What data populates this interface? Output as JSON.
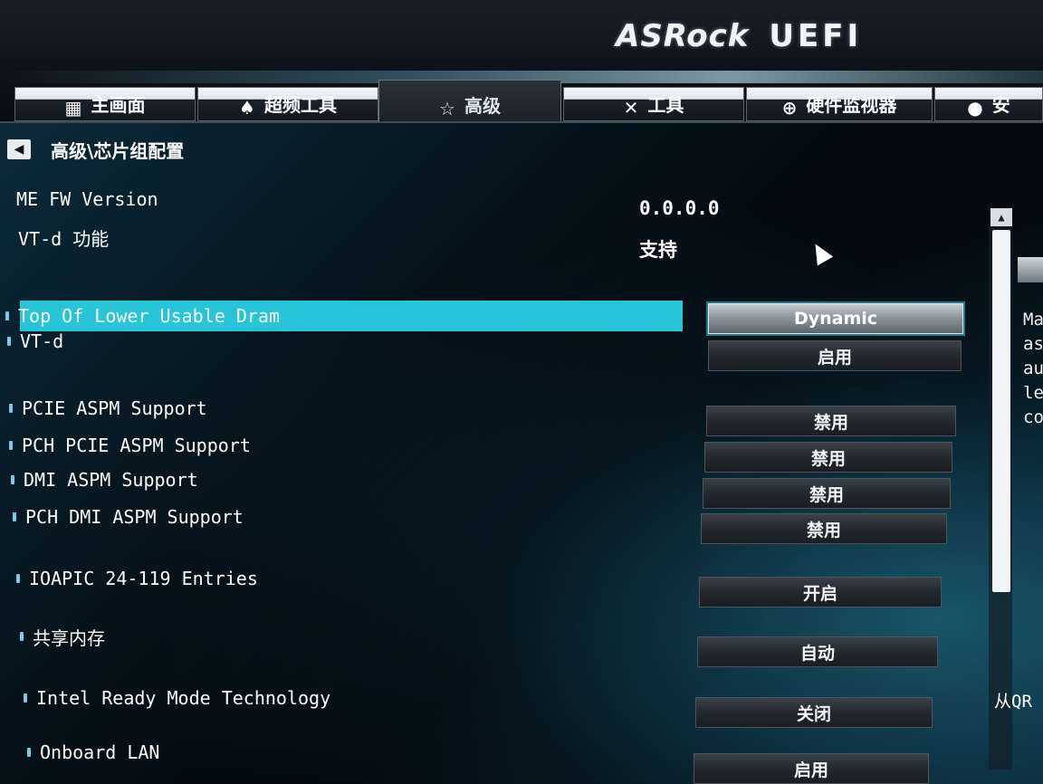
{
  "header": {
    "brand": "ASRock",
    "product": "UEFI"
  },
  "tabs": [
    {
      "label": "主画面",
      "icon": "home-icon"
    },
    {
      "label": "超频工具",
      "icon": "flame-icon"
    },
    {
      "label": "高级",
      "icon": "star-icon"
    },
    {
      "label": "工具",
      "icon": "tools-icon"
    },
    {
      "label": "硬件监视器",
      "icon": "monitor-icon"
    },
    {
      "label": "安",
      "icon": "lock-icon"
    }
  ],
  "breadcrumb": "高级\\芯片组配置",
  "info": [
    {
      "label": "ME FW Version",
      "value": "0.0.0.0"
    },
    {
      "label": "VT-d 功能",
      "value": "支持"
    }
  ],
  "settings": [
    {
      "label": "Top Of Lower Usable Dram",
      "value": "Dynamic"
    },
    {
      "label": "VT-d",
      "value": "启用"
    },
    {
      "label": "PCIE ASPM Support",
      "value": "禁用"
    },
    {
      "label": "PCH PCIE ASPM Support",
      "value": "禁用"
    },
    {
      "label": "DMI ASPM Support",
      "value": "禁用"
    },
    {
      "label": "PCH DMI ASPM Support",
      "value": "禁用"
    },
    {
      "label": "IOAPIC 24-119 Entries",
      "value": "开启"
    },
    {
      "label": "共享内存",
      "value": "自动"
    },
    {
      "label": "Intel Ready Mode Technology",
      "value": "关闭"
    },
    {
      "label": "Onboard LAN",
      "value": "启用"
    }
  ],
  "help": {
    "lines": [
      "Ma",
      "as",
      "au",
      "le",
      "co"
    ],
    "qr": "从QR"
  },
  "colors": {
    "highlight": "#28c4d8",
    "accent_bullet": "#7fc8e0"
  }
}
